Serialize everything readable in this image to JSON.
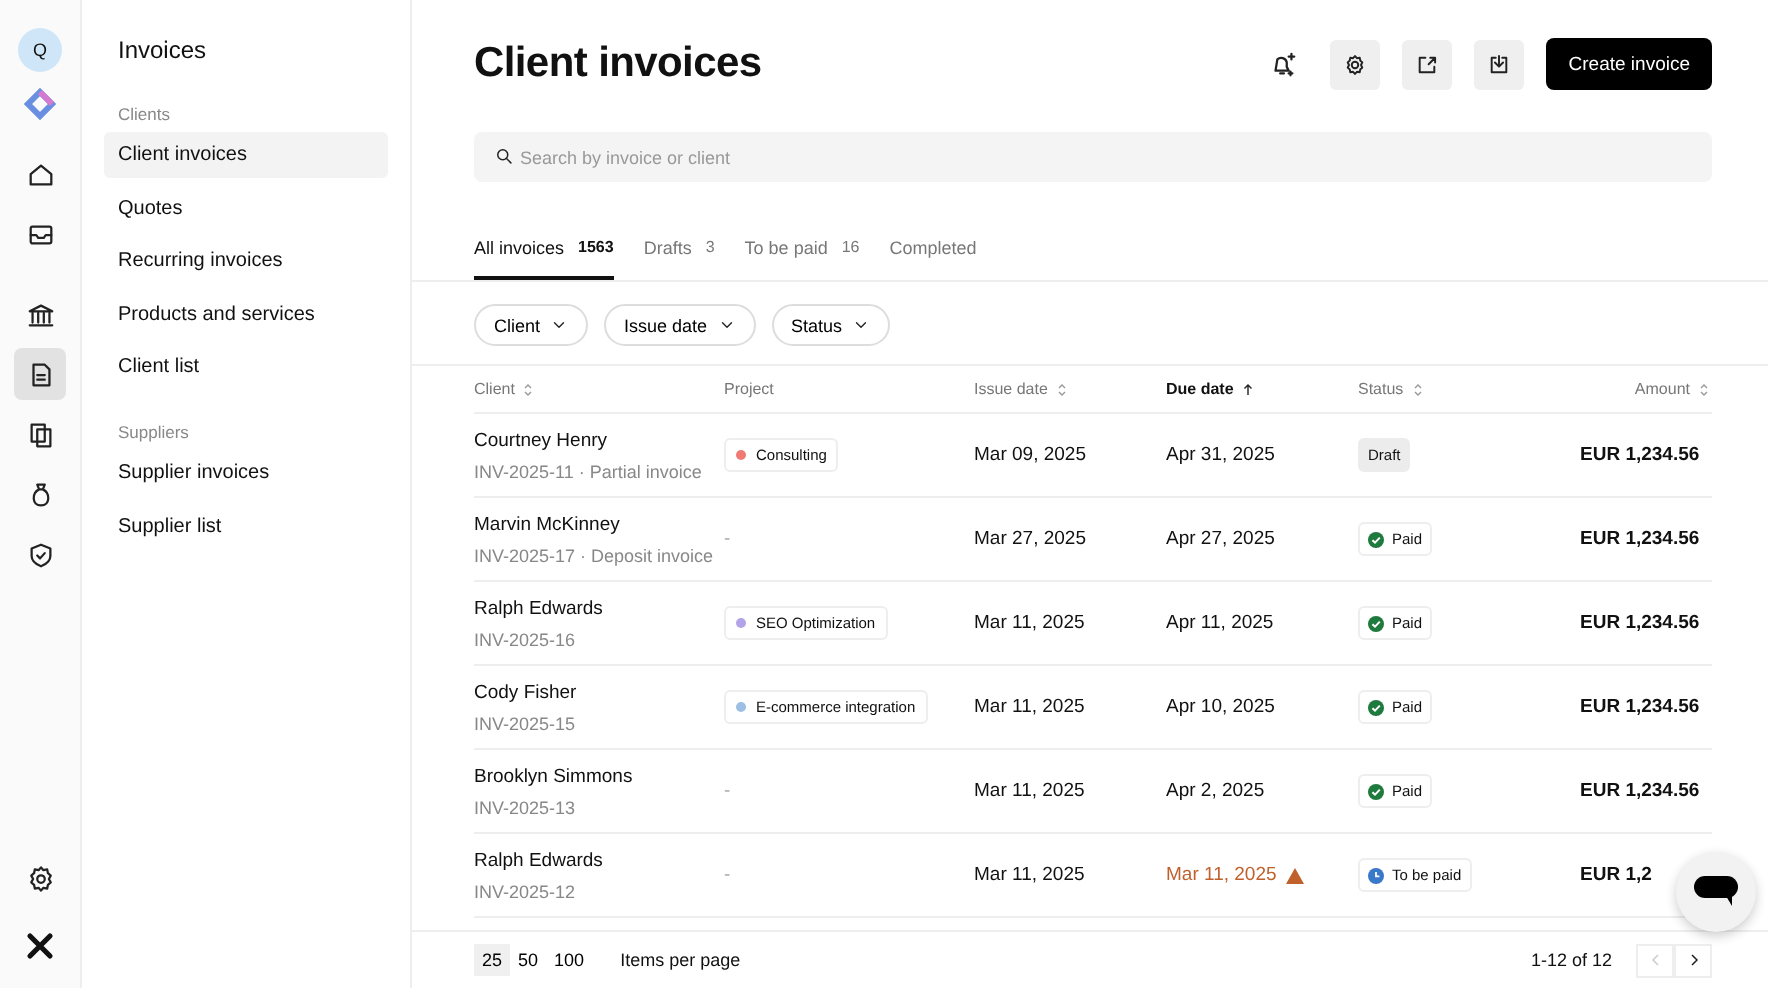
{
  "rail": {
    "avatar": "Q",
    "items": [
      {
        "selected": false
      },
      {
        "selected": false
      },
      {
        "selected": false
      },
      {
        "selected": true
      },
      {
        "selected": false
      },
      {
        "selected": false
      },
      {
        "selected": false
      }
    ]
  },
  "sidebar": {
    "title": "Invoices",
    "sections": [
      {
        "heading": "Clients",
        "items": [
          {
            "label": "Client invoices",
            "selected": true
          },
          {
            "label": "Quotes",
            "selected": false
          },
          {
            "label": "Recurring invoices",
            "selected": false
          },
          {
            "label": "Products and services",
            "selected": false
          },
          {
            "label": "Client list",
            "selected": false
          }
        ]
      },
      {
        "heading": "Suppliers",
        "items": [
          {
            "label": "Supplier invoices",
            "selected": false
          },
          {
            "label": "Supplier list",
            "selected": false
          }
        ]
      }
    ]
  },
  "header": {
    "title": "Client invoices",
    "primary_button": "Create invoice"
  },
  "search": {
    "placeholder": "Search by invoice or client"
  },
  "tabs": [
    {
      "label": "All invoices",
      "count": "1563",
      "selected": true
    },
    {
      "label": "Drafts",
      "count": "3",
      "selected": false
    },
    {
      "label": "To be paid",
      "count": "16",
      "selected": false
    },
    {
      "label": "Completed",
      "selected": false
    }
  ],
  "filters": [
    "Client",
    "Issue date",
    "Status"
  ],
  "table": {
    "columns": [
      {
        "label": "Client",
        "sortable": true,
        "sorted": false
      },
      {
        "label": "Project",
        "sortable": false,
        "sorted": false
      },
      {
        "label": "Issue date",
        "sortable": true,
        "sorted": false
      },
      {
        "label": "Due date",
        "sortable": true,
        "sorted": true
      },
      {
        "label": "Status",
        "sortable": true,
        "sorted": false
      },
      {
        "label": "Amount",
        "sortable": true,
        "sorted": false
      }
    ],
    "rows": [
      {
        "client": "Courtney Henry",
        "invoice": "INV-2025-11 · Partial invoice",
        "project": {
          "kind": "tag",
          "label": "Consulting",
          "color": "#f07a73"
        },
        "issue_date": "Mar 09, 2025",
        "due_date": "Apr 31, 2025",
        "overdue": false,
        "status": {
          "kind": "draft",
          "label": "Draft"
        },
        "amount": "EUR 1,234.56"
      },
      {
        "client": "Marvin McKinney",
        "invoice": "INV-2025-17 · Deposit invoice",
        "project": {
          "kind": "none",
          "label": "-"
        },
        "issue_date": "Mar 27, 2025",
        "due_date": "Apr 27, 2025",
        "overdue": false,
        "status": {
          "kind": "paid",
          "label": "Paid"
        },
        "amount": "EUR 1,234.56"
      },
      {
        "client": "Ralph Edwards",
        "invoice": "INV-2025-16",
        "project": {
          "kind": "tag",
          "label": "SEO Optimization",
          "color": "#b3a4ea"
        },
        "issue_date": "Mar 11, 2025",
        "due_date": "Apr 11, 2025",
        "overdue": false,
        "status": {
          "kind": "paid",
          "label": "Paid"
        },
        "amount": "EUR 1,234.56"
      },
      {
        "client": "Cody Fisher",
        "invoice": "INV-2025-15",
        "project": {
          "kind": "tag",
          "label": "E-commerce integration",
          "color": "#9dbfe3"
        },
        "issue_date": "Mar 11, 2025",
        "due_date": "Apr 10, 2025",
        "overdue": false,
        "status": {
          "kind": "paid",
          "label": "Paid"
        },
        "amount": "EUR 1,234.56"
      },
      {
        "client": "Brooklyn Simmons",
        "invoice": "INV-2025-13",
        "project": {
          "kind": "none",
          "label": "-"
        },
        "issue_date": "Mar 11, 2025",
        "due_date": "Apr 2, 2025",
        "overdue": false,
        "status": {
          "kind": "paid",
          "label": "Paid"
        },
        "amount": "EUR 1,234.56"
      },
      {
        "client": "Ralph Edwards",
        "invoice": "INV-2025-12",
        "project": {
          "kind": "none",
          "label": "-"
        },
        "issue_date": "Mar 11, 2025",
        "due_date": "Mar 11, 2025",
        "overdue": true,
        "status": {
          "kind": "to_be_paid",
          "label": "To be paid"
        },
        "amount": "EUR 1,2"
      }
    ]
  },
  "footer": {
    "page_sizes": [
      {
        "label": "25",
        "selected": true
      },
      {
        "label": "50",
        "selected": false
      },
      {
        "label": "100",
        "selected": false
      }
    ],
    "page_size_label": "Items per page",
    "range": "1-12 of 12",
    "prev_disabled": true,
    "next_disabled": false
  }
}
